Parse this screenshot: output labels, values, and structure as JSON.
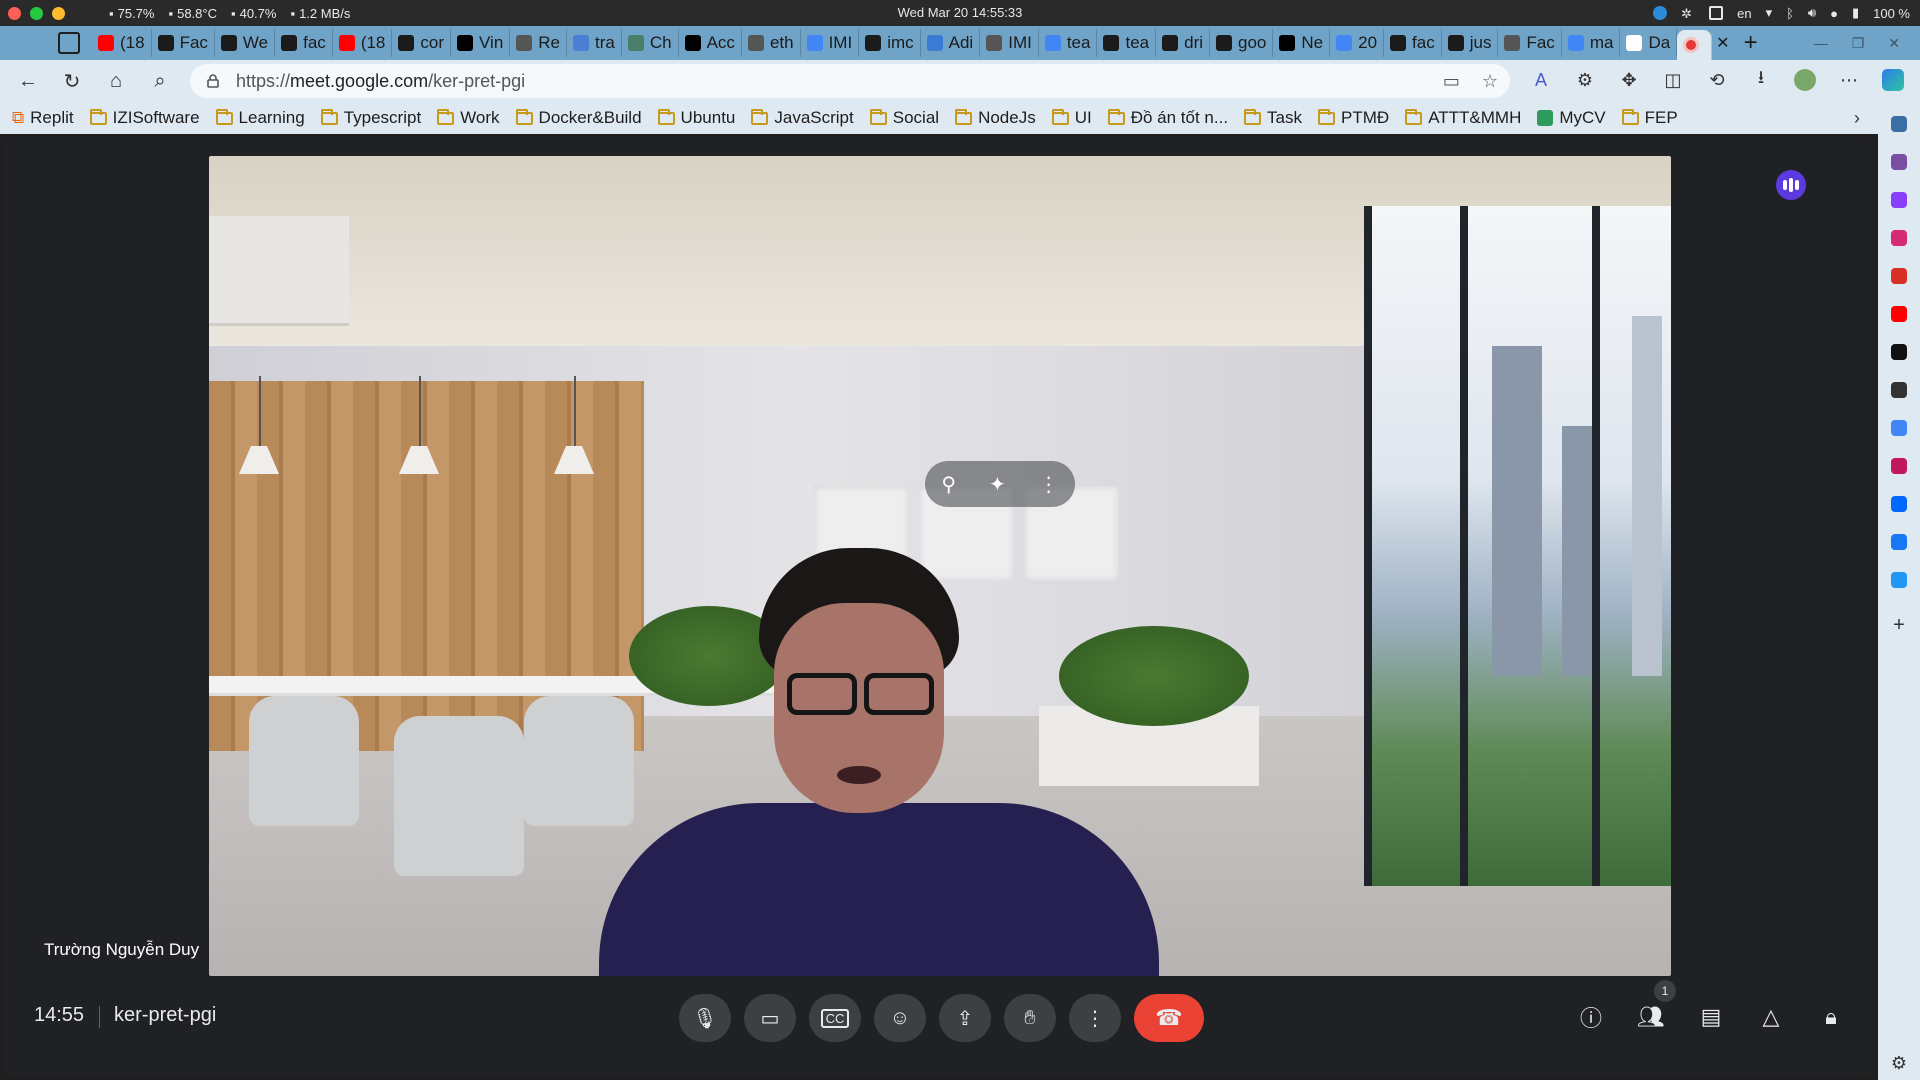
{
  "os": {
    "stats": [
      {
        "icon": "cpu-icon",
        "text": "75.7%"
      },
      {
        "icon": "thermometer-icon",
        "text": "58.8°C"
      },
      {
        "icon": "memory-icon",
        "text": "40.7%"
      },
      {
        "icon": "network-icon",
        "text": "1.2 MB/s"
      }
    ],
    "clock": "Wed Mar 20  14:55:33",
    "lang": "en",
    "battery": "100 %"
  },
  "tabs": [
    {
      "label": "(18",
      "icon": "youtube-icon",
      "color": "#ff0000"
    },
    {
      "label": "Fac",
      "icon": "github-icon",
      "color": "#1b1b1b"
    },
    {
      "label": "We",
      "icon": "github-icon",
      "color": "#1b1b1b"
    },
    {
      "label": "fac",
      "icon": "github-icon",
      "color": "#1b1b1b"
    },
    {
      "label": "(18",
      "icon": "youtube-icon",
      "color": "#ff0000"
    },
    {
      "label": "cor",
      "icon": "github-icon",
      "color": "#1b1b1b"
    },
    {
      "label": "Vin",
      "icon": "medium-icon",
      "color": "#000000"
    },
    {
      "label": "Re",
      "icon": "page-icon",
      "color": "#555555"
    },
    {
      "label": "tra",
      "icon": "google-translate-icon",
      "color": "#4a7fd4"
    },
    {
      "label": "Ch",
      "icon": "chatgpt-icon",
      "color": "#4a7f6a"
    },
    {
      "label": "Acc",
      "icon": "medium-icon",
      "color": "#000000"
    },
    {
      "label": "eth",
      "icon": "page-icon",
      "color": "#555555"
    },
    {
      "label": "IMI",
      "icon": "google-icon",
      "color": "#4285f4"
    },
    {
      "label": "imc",
      "icon": "github-icon",
      "color": "#1b1b1b"
    },
    {
      "label": "Adi",
      "icon": "image-icon",
      "color": "#3a7bd5"
    },
    {
      "label": "IMI",
      "icon": "page-icon",
      "color": "#555555"
    },
    {
      "label": "tea",
      "icon": "google-icon",
      "color": "#4285f4"
    },
    {
      "label": "tea",
      "icon": "github-icon",
      "color": "#1b1b1b"
    },
    {
      "label": "dri",
      "icon": "github-icon",
      "color": "#1b1b1b"
    },
    {
      "label": "goo",
      "icon": "github-icon",
      "color": "#1b1b1b"
    },
    {
      "label": "Ne",
      "icon": "circle-icon",
      "color": "#000000"
    },
    {
      "label": "20",
      "icon": "google-icon",
      "color": "#4285f4"
    },
    {
      "label": "fac",
      "icon": "github-icon",
      "color": "#1b1b1b"
    },
    {
      "label": "jus",
      "icon": "github-icon",
      "color": "#1b1b1b"
    },
    {
      "label": "Fac",
      "icon": "page-icon",
      "color": "#555555"
    },
    {
      "label": "ma",
      "icon": "google-icon",
      "color": "#4285f4"
    },
    {
      "label": "Da",
      "icon": "notion-icon",
      "color": "#ffffff"
    },
    {
      "label": "",
      "icon": "recording-icon",
      "color": "#e53935",
      "active": true
    }
  ],
  "address": {
    "scheme": "https://",
    "host": "meet.google.com",
    "path": "/ker-pret-pgi"
  },
  "bookmarks": [
    {
      "label": "Replit",
      "icon": "replit-icon"
    },
    {
      "label": "IZISoftware",
      "icon": "folder-icon"
    },
    {
      "label": "Learning",
      "icon": "folder-icon"
    },
    {
      "label": "Typescript",
      "icon": "folder-icon"
    },
    {
      "label": "Work",
      "icon": "folder-icon"
    },
    {
      "label": "Docker&Build",
      "icon": "folder-icon"
    },
    {
      "label": "Ubuntu",
      "icon": "folder-icon"
    },
    {
      "label": "JavaScript",
      "icon": "folder-icon"
    },
    {
      "label": "Social",
      "icon": "folder-icon"
    },
    {
      "label": "NodeJs",
      "icon": "folder-icon"
    },
    {
      "label": "UI",
      "icon": "folder-icon"
    },
    {
      "label": "Đồ án tốt n...",
      "icon": "folder-icon"
    },
    {
      "label": "Task",
      "icon": "folder-icon"
    },
    {
      "label": "PTMĐ",
      "icon": "folder-icon"
    },
    {
      "label": "ATTT&MMH",
      "icon": "folder-icon"
    },
    {
      "label": "MyCV",
      "icon": "mycv-icon"
    },
    {
      "label": "FEP",
      "icon": "folder-icon"
    }
  ],
  "sidebar_apps": [
    {
      "icon": "search-icon",
      "color": "#3a6ea5"
    },
    {
      "icon": "tools-icon",
      "color": "#7a4ea3"
    },
    {
      "icon": "messenger-icon",
      "color": "#8a3ffc"
    },
    {
      "icon": "instagram-icon",
      "color": "#d62976"
    },
    {
      "icon": "gmail-icon",
      "color": "#d93025"
    },
    {
      "icon": "youtube-icon",
      "color": "#ff0000"
    },
    {
      "icon": "tiktok-icon",
      "color": "#111111"
    },
    {
      "icon": "chatgpt-icon",
      "color": "#333333"
    },
    {
      "icon": "google-icon",
      "color": "#4285f4"
    },
    {
      "icon": "app-icon",
      "color": "#c2185b"
    },
    {
      "icon": "zalo-icon",
      "color": "#0068ff"
    },
    {
      "icon": "facebook-icon",
      "color": "#1877f2"
    },
    {
      "icon": "globe-icon",
      "color": "#2196f3"
    }
  ],
  "meet": {
    "participant_name": "Trường Nguyễn Duy",
    "clock": "14:55",
    "meeting_code": "ker-pret-pgi",
    "participants_count": "1",
    "accent_end": "#ea4335",
    "speaker_color": "#5b3be0"
  }
}
